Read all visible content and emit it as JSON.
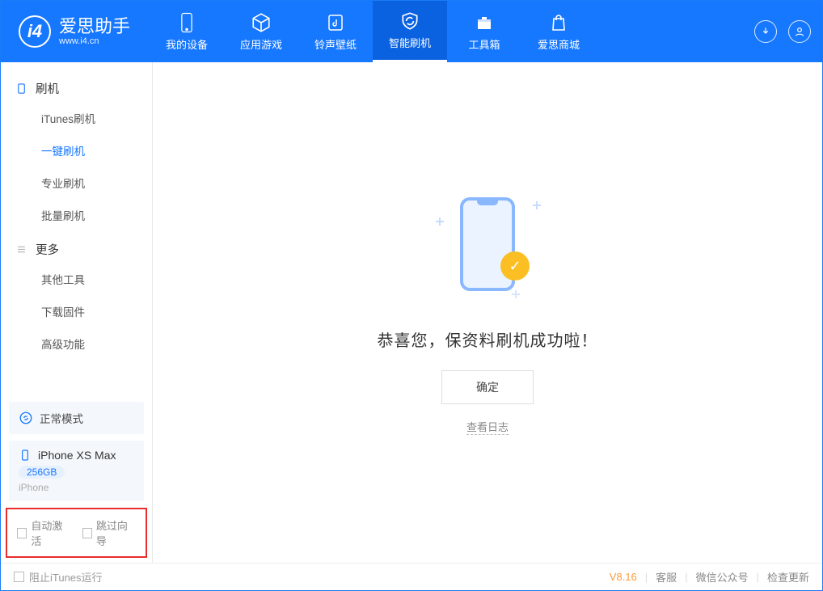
{
  "brand": {
    "title": "爱思助手",
    "sub": "www.i4.cn"
  },
  "nav": [
    {
      "label": "我的设备"
    },
    {
      "label": "应用游戏"
    },
    {
      "label": "铃声壁纸"
    },
    {
      "label": "智能刷机"
    },
    {
      "label": "工具箱"
    },
    {
      "label": "爱思商城"
    }
  ],
  "sidebar": {
    "g1": {
      "title": "刷机",
      "items": [
        "iTunes刷机",
        "一键刷机",
        "专业刷机",
        "批量刷机"
      ]
    },
    "g2": {
      "title": "更多",
      "items": [
        "其他工具",
        "下载固件",
        "高级功能"
      ]
    },
    "mode": "正常模式",
    "device": {
      "name": "iPhone XS Max",
      "storage": "256GB",
      "type": "iPhone"
    },
    "checks": [
      "自动激活",
      "跳过向导"
    ]
  },
  "main": {
    "msg": "恭喜您，保资料刷机成功啦！",
    "ok": "确定",
    "log": "查看日志"
  },
  "footer": {
    "block": "阻止iTunes运行",
    "version": "V8.16",
    "links": [
      "客服",
      "微信公众号",
      "检查更新"
    ]
  }
}
